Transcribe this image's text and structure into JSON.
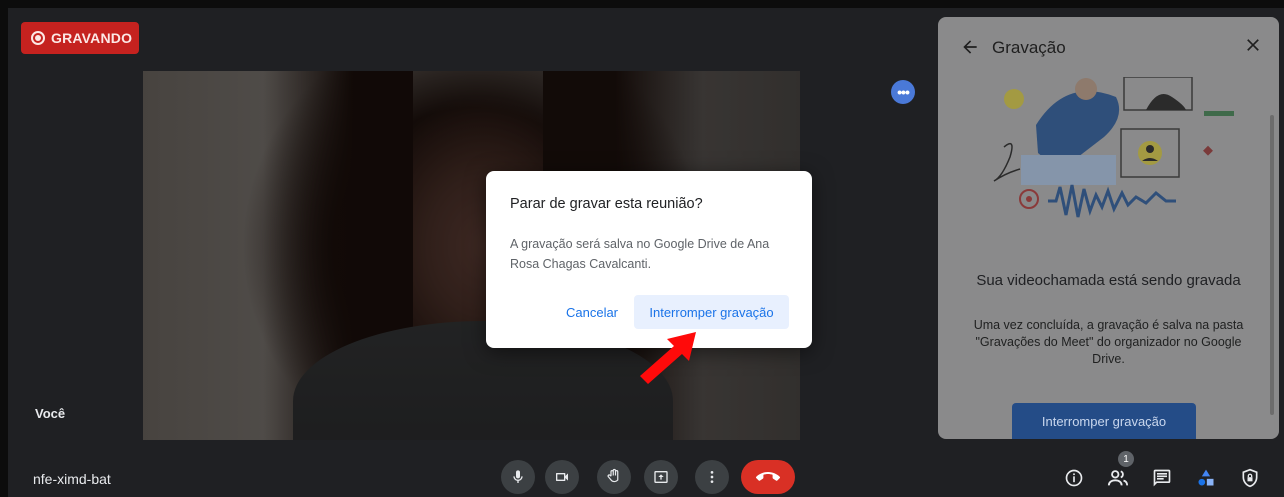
{
  "recording_badge": {
    "label": "GRAVANDO"
  },
  "self_view": {
    "label": "Você"
  },
  "meeting": {
    "code": "nfe-ximd-bat",
    "participant_count": "1"
  },
  "panel": {
    "title": "Gravação",
    "heading": "Sua videochamada está sendo gravada",
    "description": "Uma vez concluída, a gravação é salva na pasta \"Gravações do Meet\" do organizador no Google Drive.",
    "stop_button": "Interromper gravação"
  },
  "dialog": {
    "title": "Parar de gravar esta reunião?",
    "body": "A gravação será salva no Google Drive de Ana Rosa Chagas Cavalcanti.",
    "cancel": "Cancelar",
    "confirm": "Interromper gravação"
  },
  "colors": {
    "recording_red": "#c5221f",
    "accent_blue": "#1a73e8",
    "end_call_red": "#d93025"
  },
  "icons": {
    "recording": "record-icon",
    "back": "arrow-back-icon",
    "close": "close-icon",
    "mic": "mic-icon",
    "camera": "camera-icon",
    "hand": "raise-hand-icon",
    "present": "present-icon",
    "more": "more-vert-icon",
    "end": "call-end-icon",
    "info": "info-icon",
    "people": "people-icon",
    "chat": "chat-icon",
    "activities": "activities-icon",
    "security": "security-icon"
  }
}
